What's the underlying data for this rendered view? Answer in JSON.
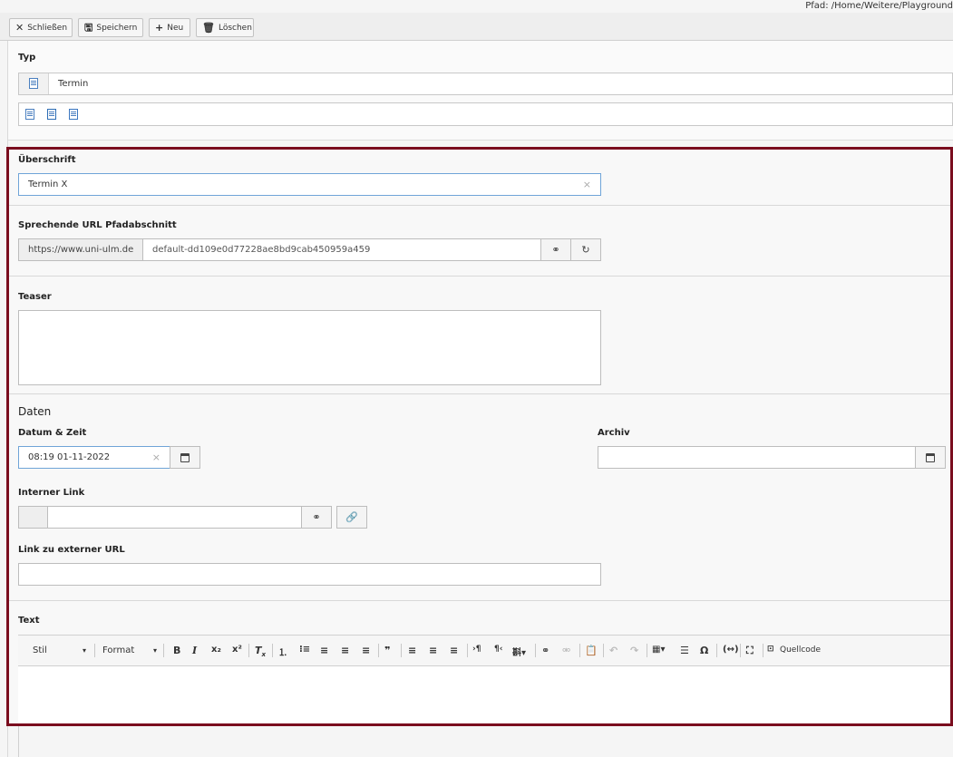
{
  "path": "Pfad: /Home/Weitere/Playground",
  "toolbar": {
    "close_label": "Schließen",
    "save_label": "Speichern",
    "new_label": "Neu",
    "delete_label": "Löschen"
  },
  "type_section": {
    "label": "Typ",
    "selected": "Termin",
    "options": [
      "text-page-icon",
      "event-page-icon",
      "gallery-page-icon"
    ]
  },
  "headline": {
    "label": "Überschrift",
    "value": "Termin X"
  },
  "url_segment": {
    "label": "Sprechende URL Pfadabschnitt",
    "prefix": "https://www.uni-ulm.de",
    "value": "default-dd109e0d77228ae8bd9cab450959a459"
  },
  "teaser": {
    "label": "Teaser",
    "value": ""
  },
  "dates": {
    "heading": "Daten",
    "datetime_label": "Datum & Zeit",
    "datetime_value": "08:19 01-11-2022",
    "archive_label": "Archiv",
    "archive_value": ""
  },
  "internal_link": {
    "label": "Interner Link",
    "value": ""
  },
  "external_link": {
    "label": "Link zu externer URL",
    "value": ""
  },
  "text": {
    "label": "Text",
    "style_label": "Stil",
    "format_label": "Format",
    "source_label": "Quellcode"
  },
  "colors": {
    "highlight_border": "#7a0d1e",
    "focus_border": "#6fa4d8"
  }
}
